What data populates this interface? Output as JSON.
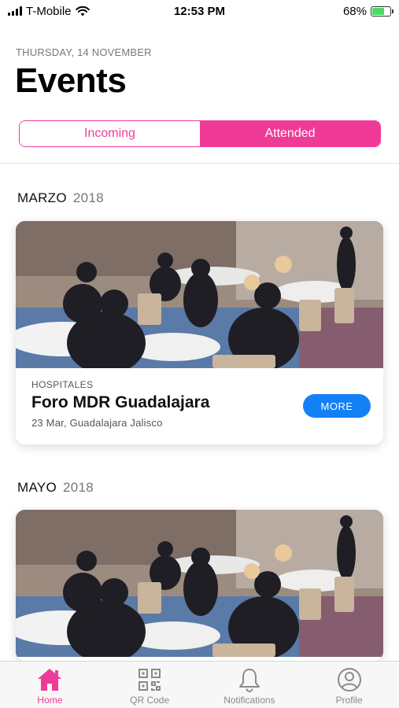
{
  "status_bar": {
    "carrier": "T-Mobile",
    "time": "12:53 PM",
    "battery": "68%",
    "battery_level": 0.68
  },
  "header": {
    "date": "THURSDAY, 14 NOVEMBER",
    "title": "Events"
  },
  "segmented": {
    "options": [
      "Incoming",
      "Attended"
    ],
    "selected": "Attended"
  },
  "sections": [
    {
      "month": "MARZO",
      "year": "2018",
      "event": {
        "category": "HOSPITALES",
        "title": "Foro MDR Guadalajara",
        "subtitle": "23 Mar, Guadalajara Jalisco",
        "button": "MORE"
      }
    },
    {
      "month": "MAYO",
      "year": "2018"
    }
  ],
  "tab_bar": {
    "active": "Home",
    "tabs": [
      {
        "label": "Home",
        "icon": "home-icon"
      },
      {
        "label": "QR Code",
        "icon": "qr-code-icon"
      },
      {
        "label": "Notifications",
        "icon": "bell-icon"
      },
      {
        "label": "Profile",
        "icon": "profile-icon"
      }
    ]
  },
  "colors": {
    "accent": "#ef3b97",
    "button": "#1480f5"
  }
}
